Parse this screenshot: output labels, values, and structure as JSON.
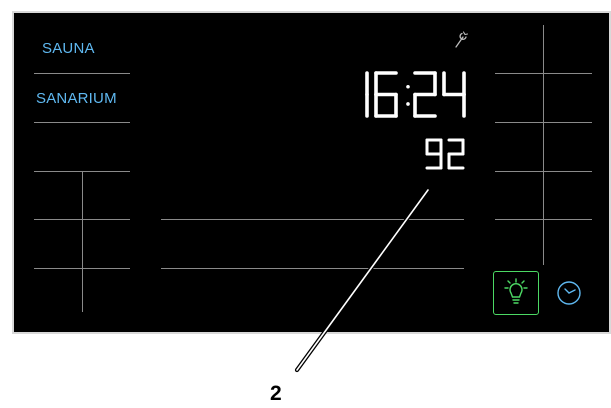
{
  "modes": {
    "sauna_label": "SAUNA",
    "sanarium_label": "SANARIUM"
  },
  "display": {
    "time": "16:24",
    "value": "92"
  },
  "icons": {
    "service": "wrench-icon",
    "light": "light-bulb-icon",
    "timer": "clock-icon"
  },
  "colors": {
    "panel_background": "#000000",
    "mode_text": "#5fb8f0",
    "segment_digits": "#ffffff",
    "light_button_border": "#4cd964",
    "divider_lines": "#8a8a8a"
  },
  "callout": {
    "label": "2"
  }
}
